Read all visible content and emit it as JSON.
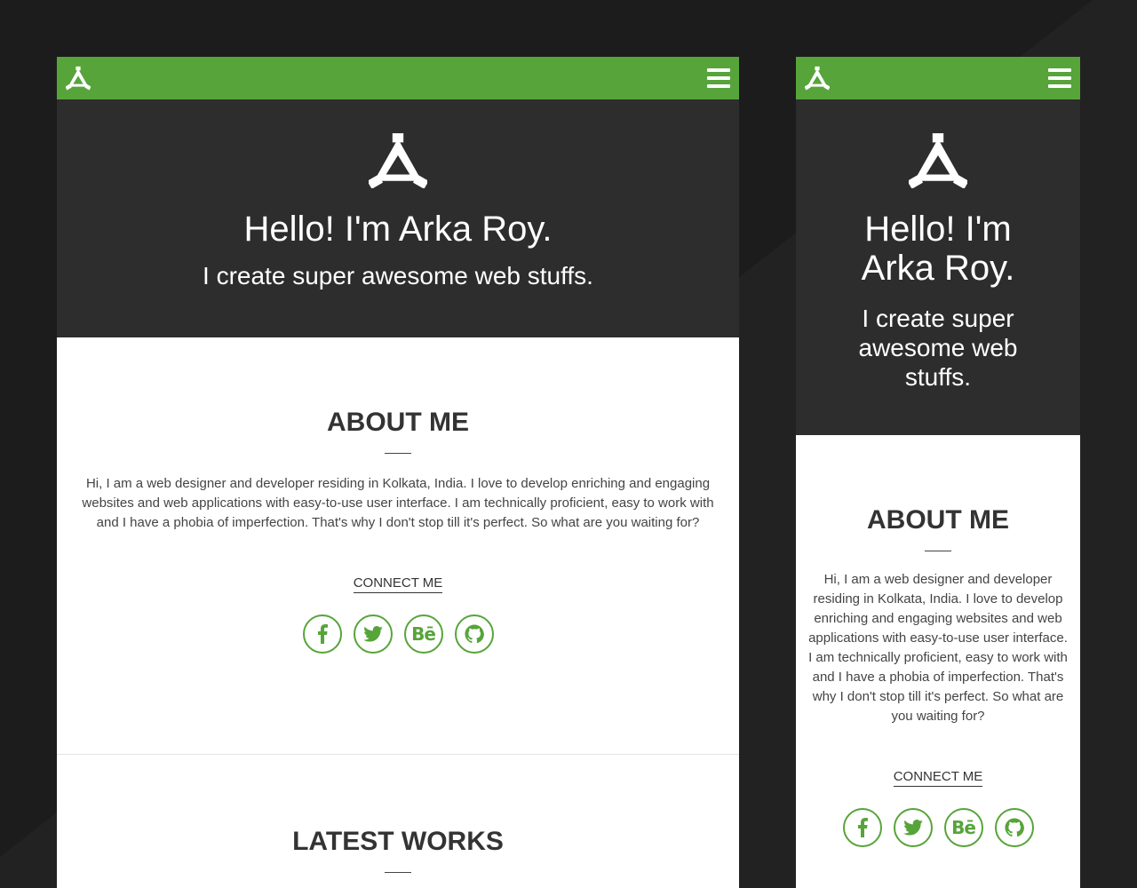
{
  "colors": {
    "brand_green": "#57a43a",
    "hero_bg": "#2d2d2d",
    "page_bg": "#1c1c1c",
    "text_dark": "#333333"
  },
  "icons": {
    "logo": "triangle-logo-icon",
    "menu": "hamburger-menu-icon",
    "facebook": "facebook-icon",
    "twitter": "twitter-icon",
    "behance": "behance-icon",
    "github": "github-icon"
  },
  "hero": {
    "title": "Hello! I'm Arka Roy.",
    "subtitle": "I create super awesome web stuffs."
  },
  "about": {
    "heading": "ABOUT ME",
    "bio": "Hi, I am a web designer and developer residing in Kolkata, India. I love to develop enriching and engaging websites and web applications with easy-to-use user interface. I am technically proficient, easy to work with and I have a phobia of imperfection. That's why I don't stop till it's perfect. So what are you waiting for?",
    "connect_label": "CONNECT ME",
    "social_behance_text": "Bē"
  },
  "works": {
    "heading": "LATEST WORKS"
  }
}
